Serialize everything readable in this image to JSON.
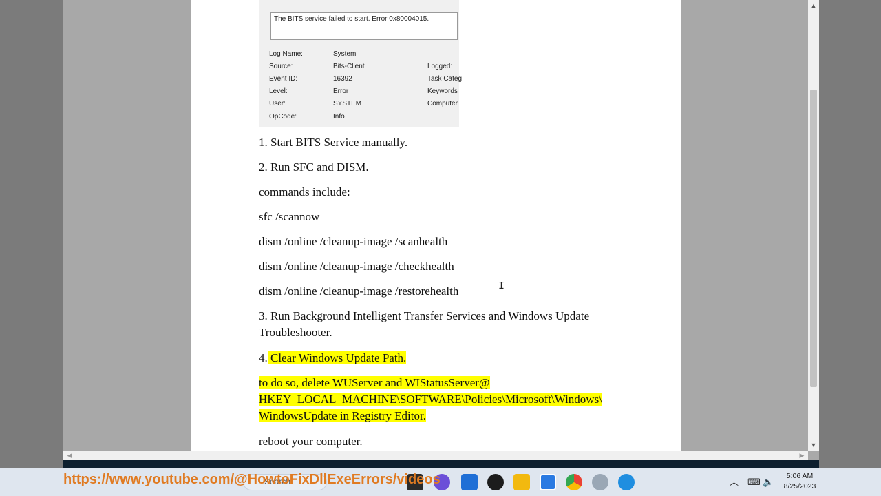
{
  "event_screenshot": {
    "message": "The BITS service failed to start.  Error 0x80004015.",
    "fields": [
      {
        "label": "Log Name:",
        "value": "System",
        "right": ""
      },
      {
        "label": "Source:",
        "value": "Bits-Client",
        "right": "Logged:"
      },
      {
        "label": "Event ID:",
        "value": "16392",
        "right": "Task Categ"
      },
      {
        "label": "Level:",
        "value": "Error",
        "right": "Keywords"
      },
      {
        "label": "User:",
        "value": "SYSTEM",
        "right": "Computer"
      },
      {
        "label": "OpCode:",
        "value": "Info",
        "right": ""
      }
    ]
  },
  "document": {
    "step1": "1. Start BITS Service manually.",
    "step2": "2. Run SFC and DISM.",
    "commands_intro": "commands include:",
    "cmd_sfc": "sfc /scannow",
    "cmd_scan": "dism /online /cleanup-image /scanhealth",
    "cmd_check": "dism /online /cleanup-image /checkhealth",
    "cmd_restore": "dism /online /cleanup-image /restorehealth",
    "step3_line1": "3. Run Background Intelligent Transfer Services and Windows Update",
    "step3_line2": "Troubleshooter.",
    "step4_num": "4.",
    "step4_text": " Clear Windows Update Path.",
    "reg_line1": "to do so, delete WUServer and WIStatusServer@ ",
    "reg_line2": "HKEY_LOCAL_MACHINE\\SOFTWARE\\Policies\\Microsoft\\Windows\\",
    "reg_line3": "WindowsUpdate in Registry Editor.",
    "reboot": "reboot your computer."
  },
  "overlay_url": "https://www.youtube.com/@HowtoFixDllExeErrors/videos",
  "taskbar": {
    "search_label": "Search",
    "time": "5:06 AM",
    "date": "8/25/2023"
  },
  "colors": {
    "highlight": "#ffff00",
    "overlay_text": "#e07b22",
    "taskbar_bg": "#dfe6ef"
  }
}
